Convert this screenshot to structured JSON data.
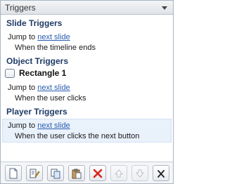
{
  "panel": {
    "title": "Triggers",
    "dropdown_icon": "chevron-down-icon"
  },
  "slide_triggers": {
    "heading": "Slide Triggers",
    "items": [
      {
        "action_prefix": "Jump to",
        "action_link": "next slide",
        "condition": "When the timeline ends"
      }
    ]
  },
  "object_triggers": {
    "heading": "Object Triggers",
    "object_name": "Rectangle 1",
    "items": [
      {
        "action_prefix": "Jump to",
        "action_link": "next slide",
        "condition": "When the user clicks"
      }
    ]
  },
  "player_triggers": {
    "heading": "Player Triggers",
    "items": [
      {
        "action_prefix": "Jump to",
        "action_link": "next slide",
        "condition": "When the user clicks the next button",
        "selected": true
      }
    ]
  },
  "toolbar": {
    "buttons": [
      {
        "name": "new-trigger",
        "icon": "new-page-icon",
        "enabled": true
      },
      {
        "name": "edit-trigger",
        "icon": "edit-icon",
        "enabled": true
      },
      {
        "name": "copy-trigger",
        "icon": "copy-icon",
        "enabled": true
      },
      {
        "name": "paste-trigger",
        "icon": "paste-icon",
        "enabled": true
      },
      {
        "name": "delete-trigger",
        "icon": "delete-x-icon",
        "enabled": true
      },
      {
        "name": "move-up",
        "icon": "up-arrow-icon",
        "enabled": false
      },
      {
        "name": "move-down",
        "icon": "down-arrow-icon",
        "enabled": false
      },
      {
        "name": "manage-variables",
        "icon": "variable-x-icon",
        "enabled": true
      }
    ]
  },
  "colors": {
    "heading": "#1f3a66",
    "link": "#2a5db0",
    "selection": "#e9f1fb",
    "delete": "#d9251c"
  }
}
